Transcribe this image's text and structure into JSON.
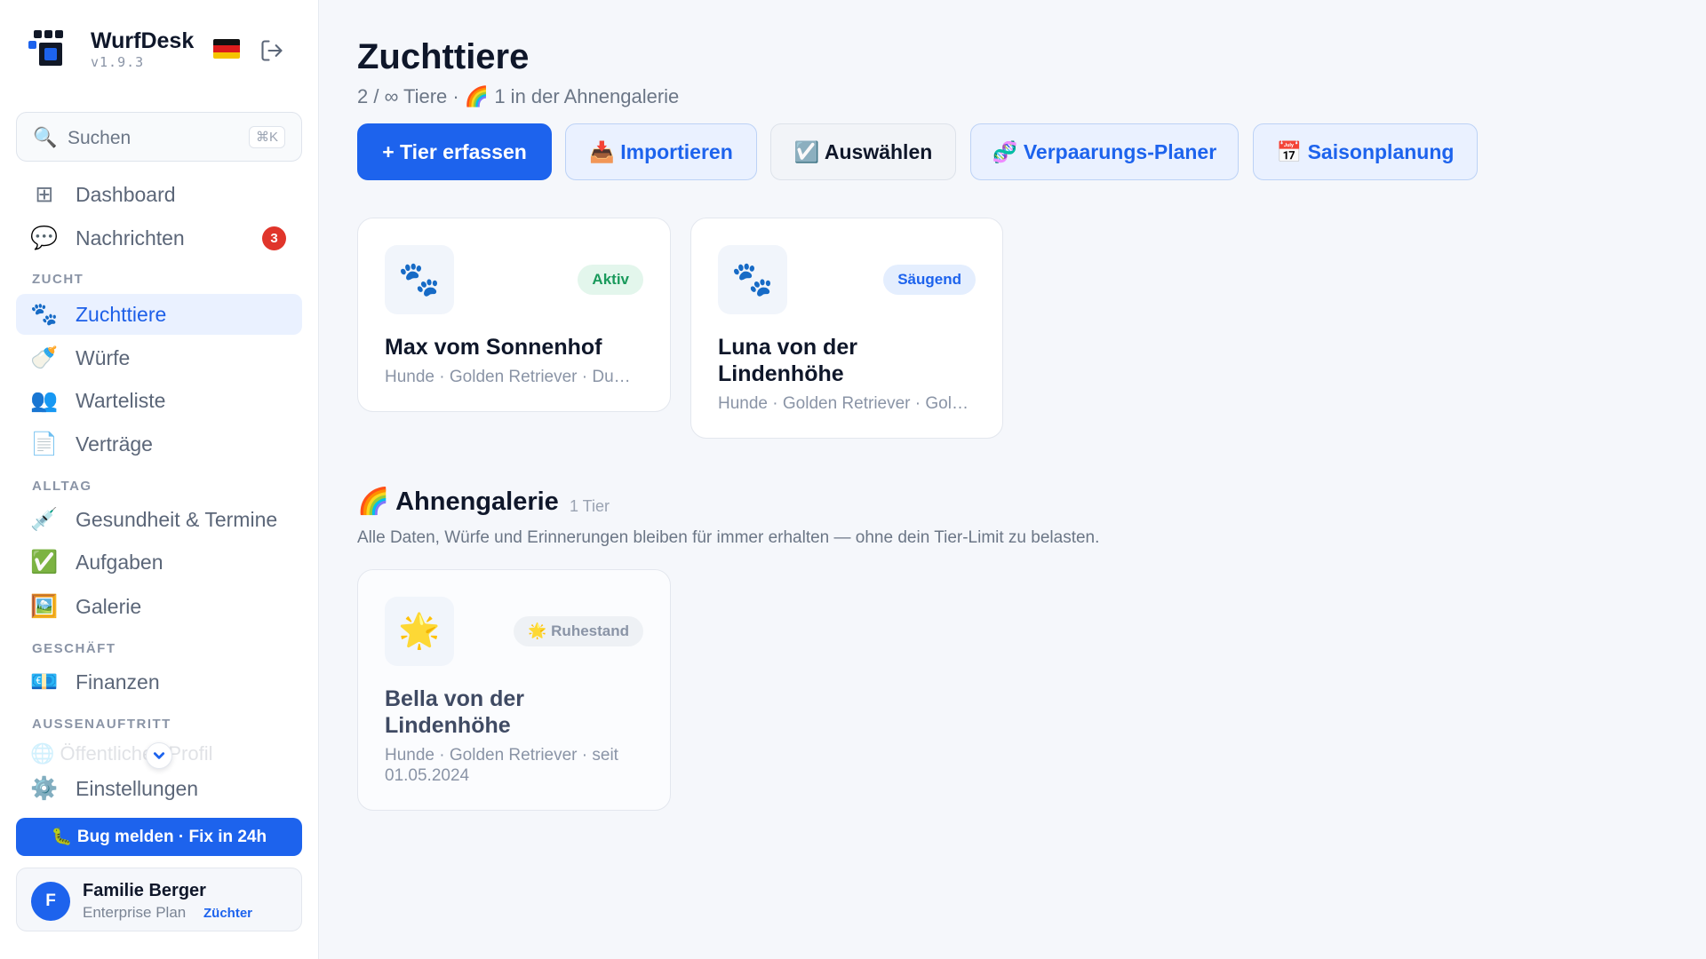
{
  "app": {
    "name": "WurfDesk",
    "version": "v1.9.3"
  },
  "search": {
    "icon": "magnifier-icon",
    "label": "Suchen",
    "shortcut": "⌘K"
  },
  "sidebar": {
    "top_items": [
      {
        "icon": "⊞",
        "label": "Dashboard"
      },
      {
        "icon": "💬",
        "label": "Nachrichten",
        "badge": "3"
      }
    ],
    "sections": [
      {
        "title": "ZUCHT"
      },
      {
        "title": "ALLTAG"
      },
      {
        "title": "GESCHÄFT"
      },
      {
        "title": "AUSSENAUFTRITT"
      }
    ],
    "zucht_items": [
      {
        "icon": "🐾",
        "label": "Zuchttiere"
      },
      {
        "icon": "🍼",
        "label": "Würfe"
      },
      {
        "icon": "👥",
        "label": "Warteliste"
      },
      {
        "icon": "📄",
        "label": "Verträge"
      }
    ],
    "alltag_items": [
      {
        "icon": "💉",
        "label": "Gesundheit & Termine"
      },
      {
        "icon": "✅",
        "label": "Aufgaben"
      },
      {
        "icon": "🖼️",
        "label": "Galerie"
      }
    ],
    "geschaeft_items": [
      {
        "icon": "💶",
        "label": "Finanzen"
      }
    ],
    "faded_item": "🌐 Öffentliches Profil",
    "settings": {
      "icon": "⚙️",
      "label": "Einstellungen"
    },
    "bug_button": "🐛 Bug melden · Fix in 24h",
    "user": {
      "initial": "F",
      "name": "Familie Berger",
      "plan": "Enterprise Plan",
      "role": "Züchter"
    }
  },
  "main": {
    "title": "Zuchttiere",
    "subtitle": "2 / ∞ Tiere · 🌈 1 in der Ahnengalerie",
    "buttons": {
      "add": "+ Tier erfassen",
      "import": "📥 Importieren",
      "select": "☑️ Auswählen",
      "mating": "🧬 Verpaarungs-Planer",
      "season": "📅 Saisonplanung"
    },
    "animals": [
      {
        "icon": "🐾",
        "status": "Aktiv",
        "name": "Max vom Sonnenhof",
        "meta": "Hunde · Golden Retriever · Du…"
      },
      {
        "icon": "🐾",
        "status": "Säugend",
        "name": "Luna von der Lindenhöhe",
        "meta": "Hunde · Golden Retriever · Gol…"
      }
    ],
    "gallery": {
      "title": "🌈 Ahnengalerie",
      "count": "1 Tier",
      "description": "Alle Daten, Würfe und Erinnerungen bleiben für immer erhalten — ohne dein Tier-Limit zu belasten.",
      "animals": [
        {
          "icon": "🌟",
          "status": "🌟 Ruhestand",
          "name": "Bella von der Lindenhöhe",
          "meta": "Hunde · Golden Retriever · seit 01.05.2024"
        }
      ]
    }
  },
  "colors": {
    "accent": "#1d63ed",
    "badge_red": "#e0352b",
    "status_active": "#1a9a5c"
  }
}
